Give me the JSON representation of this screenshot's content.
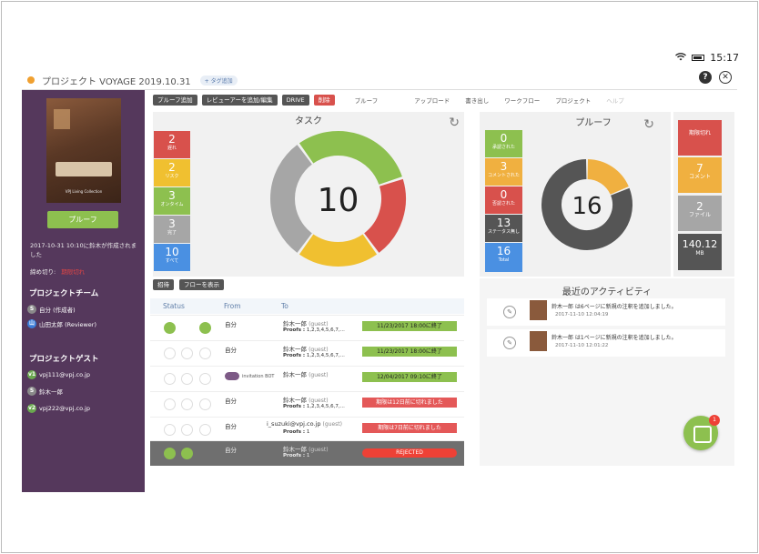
{
  "status_bar": {
    "time": "15:17"
  },
  "header": {
    "title": "プロジェクト VOYAGE 2019.10.31",
    "tag_add": "+ タグ追加"
  },
  "sidebar": {
    "cover_caption": "VPJ Living Collection",
    "proof_button": "プルーフ",
    "created_note": "2017-10-31 10:10に鈴木が作成されました",
    "deadline_label": "締め切り:",
    "deadline_value": "期限切れ",
    "team_title": "プロジェクトチーム",
    "team": [
      {
        "initial": "S",
        "name": "自分 (作成者)",
        "color": "#8a8a8a"
      },
      {
        "initial": "山",
        "name": "山田太郎 (Reviewer)",
        "color": "#3b7dd8"
      }
    ],
    "guest_title": "プロジェクトゲスト",
    "guests": [
      {
        "initial": "v1",
        "name": "vpj111@vpj.co.jp",
        "color": "#6aa84f"
      },
      {
        "initial": "S",
        "name": "鈴木一郎",
        "color": "#8a8a8a"
      },
      {
        "initial": "v2",
        "name": "vpj222@vpj.co.jp",
        "color": "#6aa84f"
      }
    ]
  },
  "toolbar": {
    "buttons": [
      "プルーフ追加",
      "レビューアーを追加/編集",
      "DRIVE",
      "削除"
    ],
    "links": [
      "プルーフ",
      "アップロード",
      "書き出し",
      "ワークフロー",
      "プロジェクト",
      "ヘルプ"
    ]
  },
  "task_panel": {
    "title": "タスク",
    "total": "10",
    "stats": [
      {
        "num": "2",
        "label": "遅れ",
        "color": "#d8514c"
      },
      {
        "num": "2",
        "label": "リスク",
        "color": "#f0c030"
      },
      {
        "num": "3",
        "label": "オンタイム",
        "color": "#8dc04f"
      },
      {
        "num": "3",
        "label": "完了",
        "color": "#a6a6a6"
      },
      {
        "num": "10",
        "label": "すべて",
        "color": "#4a90e2"
      }
    ],
    "donut": [
      {
        "value": 3,
        "color": "#8dc04f"
      },
      {
        "value": 2,
        "color": "#d8514c"
      },
      {
        "value": 2,
        "color": "#f0c030"
      },
      {
        "value": 3,
        "color": "#a6a6a6"
      }
    ]
  },
  "proof_panel": {
    "title": "プルーフ",
    "total": "16",
    "stats": [
      {
        "num": "0",
        "label": "承認された",
        "color": "#8dc04f"
      },
      {
        "num": "3",
        "label": "コメントされた",
        "color": "#f0b040"
      },
      {
        "num": "0",
        "label": "否認された",
        "color": "#d8514c"
      },
      {
        "num": "13",
        "label": "ステータス無し",
        "color": "#555555"
      },
      {
        "num": "16",
        "label": "Total",
        "color": "#4a90e2"
      }
    ],
    "donut": [
      {
        "value": 3,
        "color": "#f0b040"
      },
      {
        "value": 13,
        "color": "#555555"
      }
    ]
  },
  "side_stats": [
    {
      "num": "",
      "label": "期限切れ",
      "color": "#d8514c"
    },
    {
      "num": "7",
      "label": "コメント",
      "color": "#f0b040"
    },
    {
      "num": "2",
      "label": "ファイル",
      "color": "#a6a6a6"
    },
    {
      "num": "140.12",
      "label": "MB",
      "color": "#555555"
    }
  ],
  "actions": [
    "招待",
    "フローを表示"
  ],
  "table": {
    "headers": [
      "Status",
      "From",
      "To"
    ],
    "rows": [
      {
        "from": "自分",
        "to": "鈴木一郎",
        "guest": "(guest)",
        "proofs": "1,2,3,4,5,6,7,...",
        "badge": "11/23/2017 18:00に終了",
        "badge_type": "green",
        "icons": "green"
      },
      {
        "from": "自分",
        "to": "鈴木一郎",
        "guest": "(guest)",
        "proofs": "1,2,3,4,5,6,7,...",
        "badge": "11/23/2017 18:00に終了",
        "badge_type": "green",
        "icons": "light"
      },
      {
        "from": "",
        "to": "鈴木一郎",
        "guest": "(guest)",
        "proofs": "",
        "badge": "12/04/2017 09:10に終了",
        "badge_type": "green",
        "icons": "light",
        "bot": "invitation BOT"
      },
      {
        "from": "自分",
        "to": "鈴木一郎",
        "guest": "(guest)",
        "proofs": "1,2,3,4,5,6,7,...",
        "badge": "期限は12日前に切れました",
        "badge_type": "red",
        "icons": "light"
      },
      {
        "from": "自分",
        "to": "i_suzuki@vpj.co.jp",
        "guest": "(guest)",
        "proofs": "1",
        "badge": "期限は7日前に切れました",
        "badge_type": "red",
        "icons": "light"
      },
      {
        "from": "自分",
        "to": "鈴木一郎",
        "guest": "(guest)",
        "proofs": "1",
        "badge": "REJECTED",
        "badge_type": "rejected",
        "icons": "dark"
      }
    ],
    "proofs_label": "Proofs :"
  },
  "activity": {
    "title": "最近のアクティビティ",
    "items": [
      {
        "text": "鈴木一郎 は6ページに新規の注釈を追加しました。",
        "time": "2017-11-10 12:04:19"
      },
      {
        "text": "鈴木一郎 は1ページに新規の注釈を追加しました。",
        "time": "2017-11-10 12:01:22"
      }
    ]
  },
  "chat": {
    "badge": "1"
  }
}
